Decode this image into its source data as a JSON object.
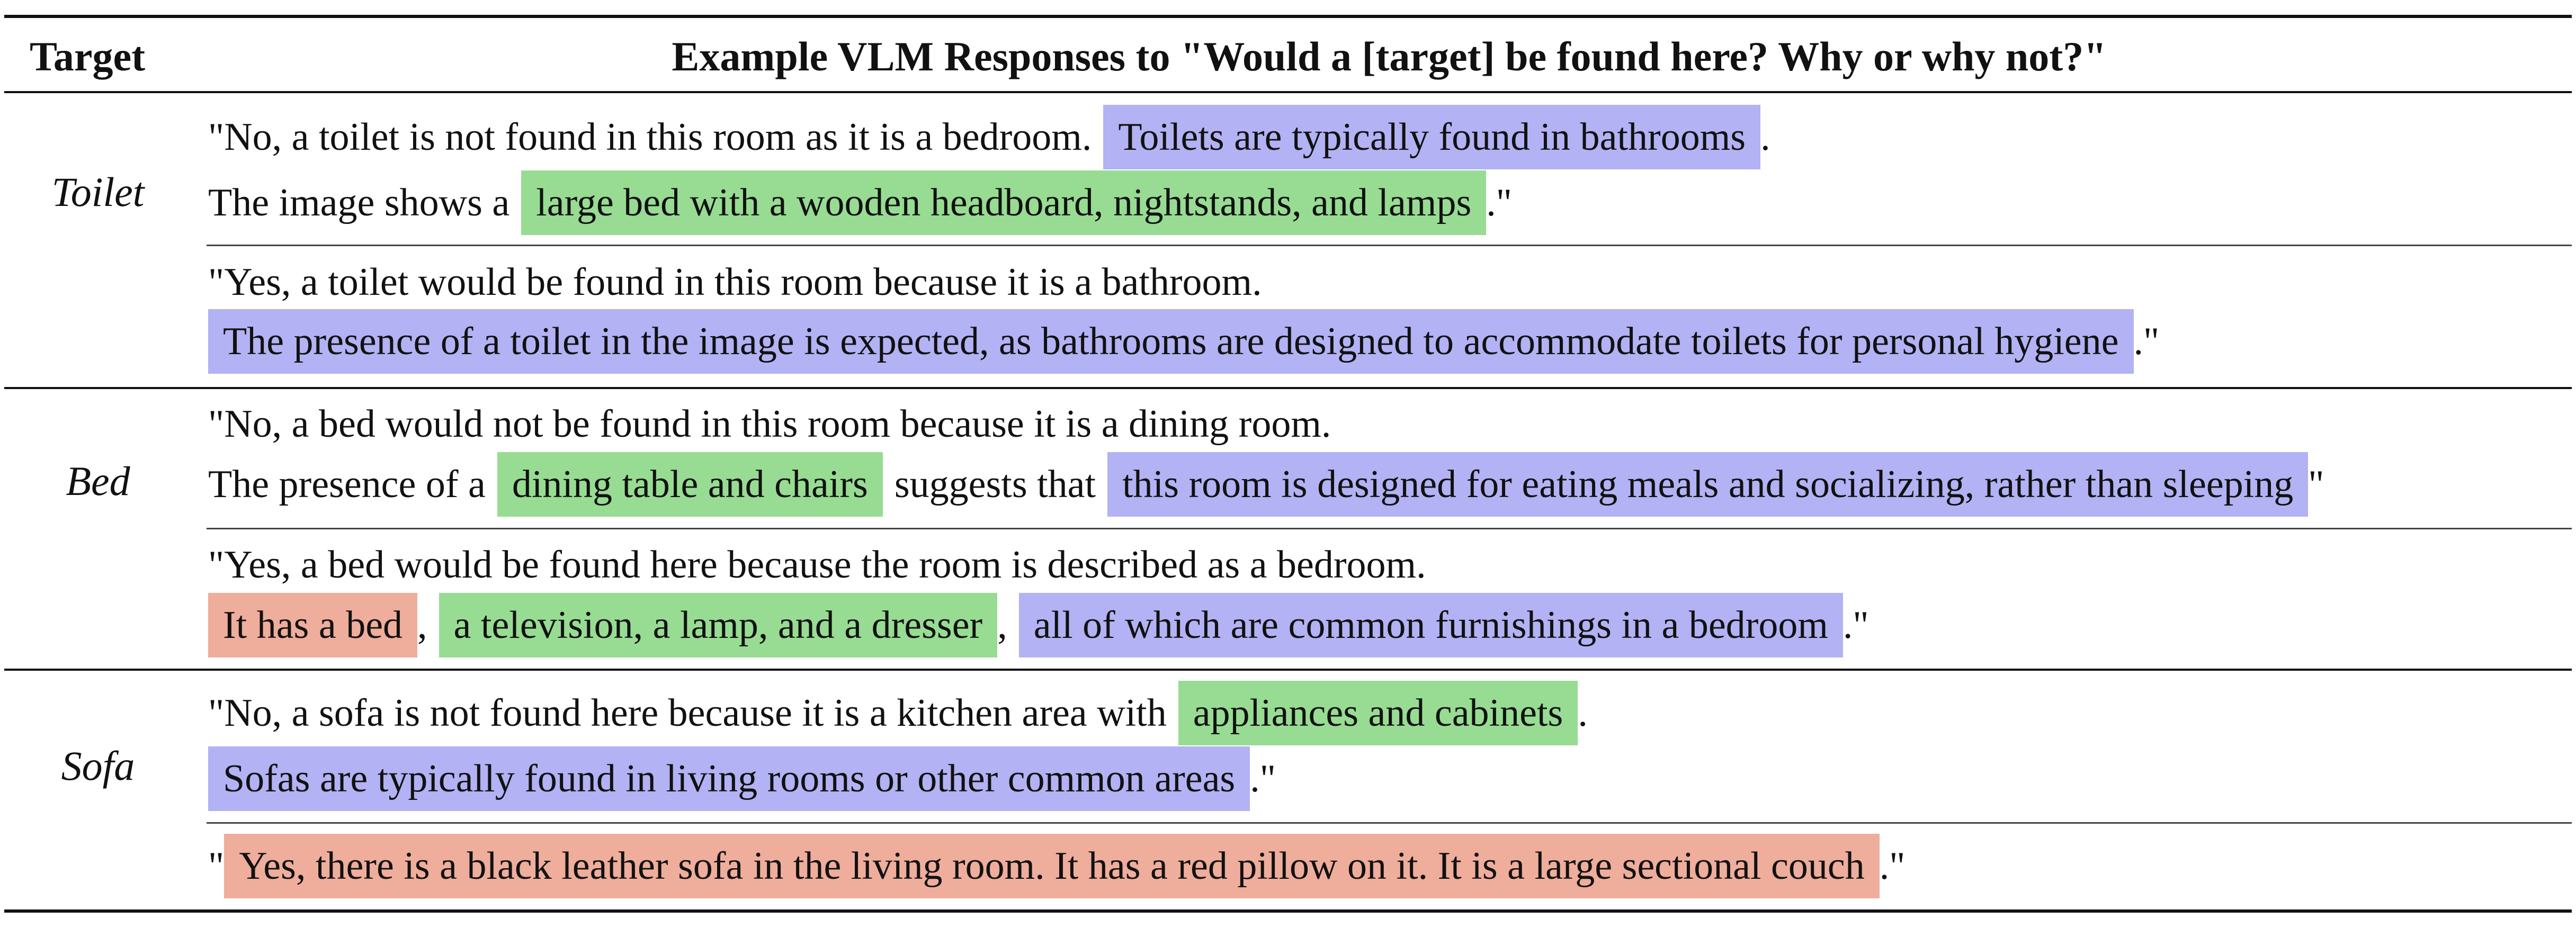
{
  "table": {
    "header": {
      "target_label": "Target",
      "title": "Example VLM Responses to \"Would a [target] be found here? Why or why not?\""
    },
    "highlight_colors": {
      "blue": "#b2b2f4",
      "green": "#97dc92",
      "red": "#efad9c"
    },
    "rows": [
      {
        "target": "Toilet",
        "responses": [
          {
            "line1": {
              "text": "\"No, a toilet is not found in this room as it is a bedroom.",
              "hl": "Toilets are typically found in bathrooms",
              "end": "."
            },
            "line2": {
              "text": "The image shows a",
              "hl": "large bed with a wooden headboard, nightstands, and lamps",
              "end": ".\""
            }
          },
          {
            "line1": {
              "text": "\"Yes, a toilet would be found in this room because it is a bathroom."
            },
            "line2": {
              "hl": "The presence of a toilet in the image is expected, as bathrooms are designed to accommodate toilets for personal hygiene",
              "end": ".\""
            }
          }
        ]
      },
      {
        "target": "Bed",
        "responses": [
          {
            "line1": {
              "text": "\"No, a bed would not be found in this room because it is a dining room."
            },
            "line2": {
              "text": "The presence of a",
              "hl1": "dining table and chairs",
              "mid": "suggests that",
              "hl2": "this room is designed for eating meals and socializing, rather than sleeping",
              "end": "\""
            }
          },
          {
            "line1": {
              "text": "\"Yes, a bed would be found here because the room is described as a bedroom."
            },
            "line2": {
              "hl1": "It has a bed",
              "sep1": ",",
              "hl2": "a television, a lamp, and a dresser",
              "sep2": ",",
              "hl3": "all of which are common furnishings in a bedroom",
              "end": ".\""
            }
          }
        ]
      },
      {
        "target": "Sofa",
        "responses": [
          {
            "line1": {
              "text": "\"No, a sofa is not found here because it is a kitchen area with",
              "hl": "appliances and cabinets",
              "end": "."
            },
            "line2": {
              "hl": "Sofas are typically found in living rooms or other common areas",
              "end": ".\""
            }
          },
          {
            "line1": {
              "start": "\"",
              "hl": "Yes, there is a black leather sofa in the living room. It has a red pillow on it. It is a large sectional couch",
              "end": ".\""
            }
          }
        ]
      }
    ]
  }
}
